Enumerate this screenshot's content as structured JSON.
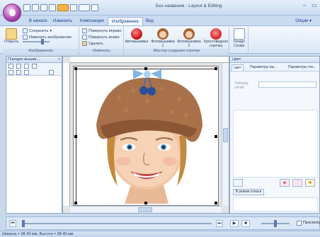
{
  "window": {
    "title": "Без названия - Layout & Editing"
  },
  "tabs": [
    "В начало",
    "Изменить",
    "Композиция",
    "Изображение",
    "Вид"
  ],
  "options_label": "Опции",
  "ribbon": {
    "open_label": "Открыть",
    "save_label": "Сохранить",
    "edit_image_label": "Изменить изображение",
    "rotate_right_label": "Повернуть вправо",
    "rotate_left_label": "Повернуть влево",
    "delete_label": "Удалить",
    "group_image": "Изображения",
    "group_change": "Изменить",
    "wizard_items": [
      {
        "label": "Автовышивка",
        "icon": "apple-icon"
      },
      {
        "label": "Фотовышивка 1",
        "icon": "face-icon"
      },
      {
        "label": "Фотовышивка 2",
        "icon": "face-icon"
      },
      {
        "label": "Крестовидная строчка",
        "icon": "heart-icon"
      }
    ],
    "design_center_label": "Design Center",
    "group_wizard": "Мастер создания строчки"
  },
  "left_panel": {
    "title": "Порядок вышив..."
  },
  "right_panel": {
    "title": "Цвет",
    "tabs": [
      "Цвет",
      "Параметры вы...",
      "Параметры тек..."
    ],
    "table_label": "Таблица нитей",
    "list_mode_label": "В режим списка"
  },
  "bottom": {
    "preview_label": "Просмотр"
  },
  "status": {
    "text": "Ширина = 98.40 мм, Высота = 98.40 мм"
  },
  "colors": {
    "accent": "#15428b",
    "ribbon": "#dbe7f6"
  }
}
